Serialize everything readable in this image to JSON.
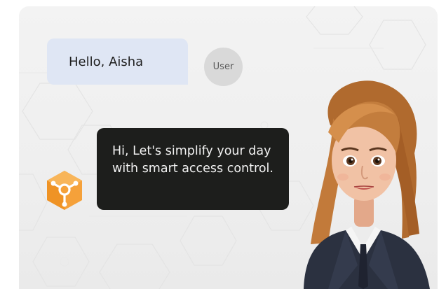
{
  "chat": {
    "user_message": "Hello, Aisha",
    "user_avatar_label": "User",
    "bot_message": "Hi, Let's simplify your day with smart access control."
  },
  "colors": {
    "user_bubble": "#dfe6f4",
    "bot_bubble": "#1d1e1c",
    "accent": "#f5a13a",
    "avatar_bg": "#d9d9d9"
  },
  "icons": {
    "bot": "orange-cube-network-icon",
    "character": "assistant-avatar-illustration"
  }
}
